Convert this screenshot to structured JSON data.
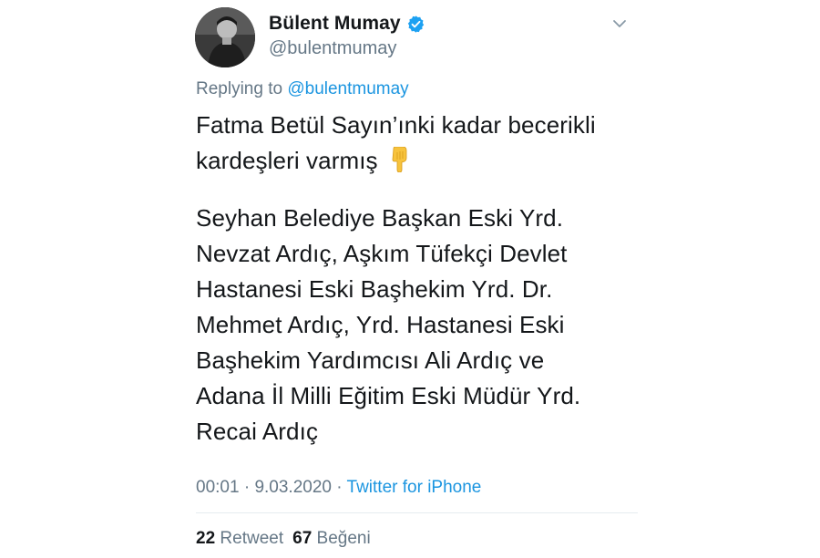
{
  "author": {
    "display_name": "Bülent Mumay",
    "handle": "@bulentmumay",
    "verified": true,
    "avatar_icon": "user-avatar"
  },
  "reply": {
    "prefix": "Replying to",
    "mention": "@bulentmumay"
  },
  "tweet": {
    "paragraph1_lines": [
      "Fatma Betül Sayın’ınki kadar becerikli",
      "kardeşleri varmış"
    ],
    "emoji_icon": "pointing-down-hand-icon",
    "paragraph2_lines": [
      "Seyhan Belediye Başkan Eski Yrd.",
      "Nevzat Ardıç, Aşkım Tüfekçi Devlet",
      "Hastanesi Eski Başhekim Yrd. Dr.",
      "Mehmet Ardıç, Yrd. Hastanesi Eski",
      "Başhekim Yardımcısı Ali Ardıç ve",
      "Adana İl Milli Eğitim Eski Müdür Yrd.",
      "Recai Ardıç"
    ]
  },
  "meta": {
    "time": "00:01",
    "separator": " · ",
    "date": "9.03.2020",
    "source": "Twitter for iPhone"
  },
  "stats": {
    "retweet_count": "22",
    "retweet_label": "Retweet",
    "like_count": "67",
    "like_label": "Beğeni"
  },
  "colors": {
    "link": "#1b95e0",
    "secondary_text": "#657786",
    "primary_text": "#14171a",
    "verified_badge": "#1da1f2"
  }
}
